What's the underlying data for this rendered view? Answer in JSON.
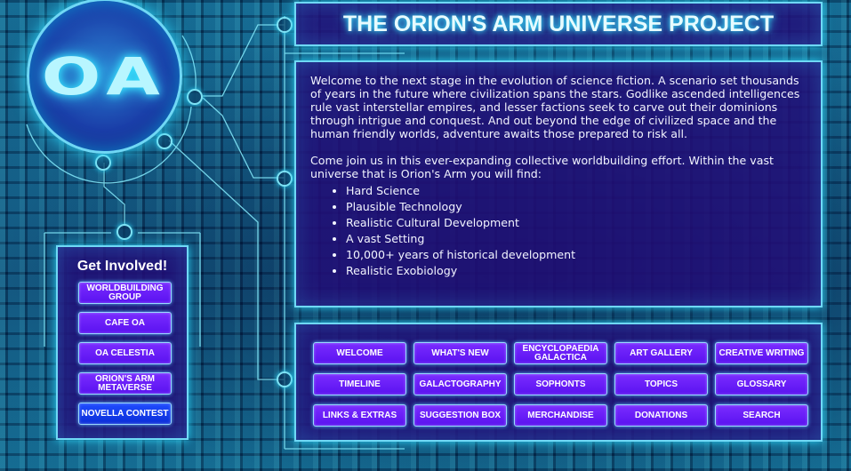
{
  "logo": {
    "text": "OA"
  },
  "header": {
    "title": "THE ORION'S ARM UNIVERSE PROJECT"
  },
  "intro": {
    "paragraph1": "Welcome to the next stage in the evolution of science fiction. A scenario set thousands of years in the future where civilization spans the stars. Godlike ascended intelligences rule vast interstellar empires, and lesser factions seek to carve out their dominions through intrigue and conquest. And out beyond the edge of civilized space and the human friendly worlds, adventure awaits those prepared to risk all.",
    "paragraph2": "Come join us in this ever-expanding collective worldbuilding effort. Within the vast universe that is Orion's Arm you will find:",
    "features": [
      "Hard Science",
      "Plausible Technology",
      "Realistic Cultural Development",
      "A vast Setting",
      "10,000+ years of historical development",
      "Realistic Exobiology"
    ]
  },
  "sidebar": {
    "title": "Get Involved!",
    "buttons": [
      "WORLDBUILDING GROUP",
      "CAFE OA",
      "OA CELESTIA",
      "ORION'S ARM METAVERSE",
      "NOVELLA CONTEST"
    ]
  },
  "nav": {
    "buttons": [
      "WELCOME",
      "WHAT'S NEW",
      "ENCYCLOPAEDIA GALACTICA",
      "ART GALLERY",
      "CREATIVE WRITING",
      "TIMELINE",
      "GALACTOGRAPHY",
      "SOPHONTS",
      "TOPICS",
      "GLOSSARY",
      "LINKS & EXTRAS",
      "SUGGESTION BOX",
      "MERCHANDISE",
      "DONATIONS",
      "SEARCH"
    ]
  },
  "colors": {
    "accent": "#6fd8f5",
    "panel": "#220e78",
    "button": "#6a1cff"
  }
}
